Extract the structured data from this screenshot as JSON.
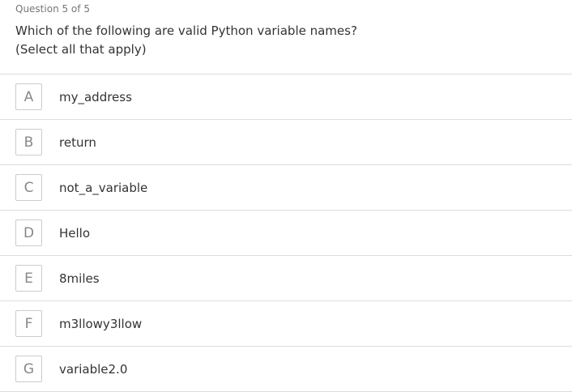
{
  "question": {
    "counter": "Question 5 of 5",
    "text": "Which of the following are valid Python variable names?",
    "hint": "(Select all that apply)"
  },
  "options": [
    {
      "letter": "A",
      "text": "my_address"
    },
    {
      "letter": "B",
      "text": "return"
    },
    {
      "letter": "C",
      "text": "not_a_variable"
    },
    {
      "letter": "D",
      "text": "Hello"
    },
    {
      "letter": "E",
      "text": "8miles"
    },
    {
      "letter": "F",
      "text": "m3llowy3llow"
    },
    {
      "letter": "G",
      "text": "variable2.0"
    }
  ]
}
